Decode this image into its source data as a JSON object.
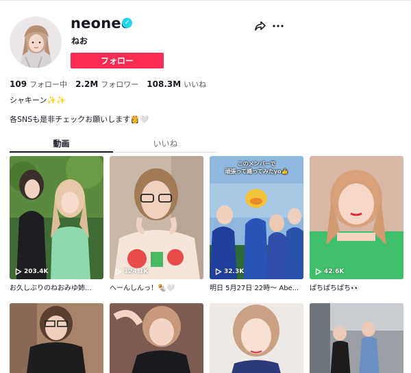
{
  "profile": {
    "username": "neoneo",
    "nickname": "ねお",
    "follow_label": "フォロー",
    "bio_line1": "シャキーン✨✨",
    "bio_line2": "各SNSも是非チェックお願いします👸🤍"
  },
  "stats": {
    "following_count": "109",
    "following_label": "フォロー中",
    "followers_count": "2.2M",
    "followers_label": "フォロワー",
    "likes_count": "108.3M",
    "likes_label": "いいね"
  },
  "tabs": {
    "videos": "動画",
    "liked": "いいね"
  },
  "videos": [
    {
      "views": "203.4K",
      "caption": "お久しぶりのねおみゆ姉...",
      "overlay": ""
    },
    {
      "views": "124.1K",
      "caption": "へーんしんっ！🌯🤍",
      "overlay": ""
    },
    {
      "views": "32.3K",
      "caption": "明日 5月27日 22時〜 Abe...",
      "overlay": "このメンバーで\n頑張って踊ってみたyo👍"
    },
    {
      "views": "42.6K",
      "caption": "ぱちぱちぱち👀",
      "overlay": ""
    },
    {
      "views": "",
      "caption": "",
      "overlay": ""
    },
    {
      "views": "",
      "caption": "",
      "overlay": ""
    },
    {
      "views": "",
      "caption": "",
      "overlay": ""
    },
    {
      "views": "",
      "caption": "",
      "overlay": ""
    }
  ],
  "colors": {
    "accent": "#fe2c55",
    "verified": "#20d5ec",
    "text": "#161823"
  },
  "icons": [
    "verified-badge-icon",
    "share-icon",
    "more-icon",
    "play-icon"
  ]
}
